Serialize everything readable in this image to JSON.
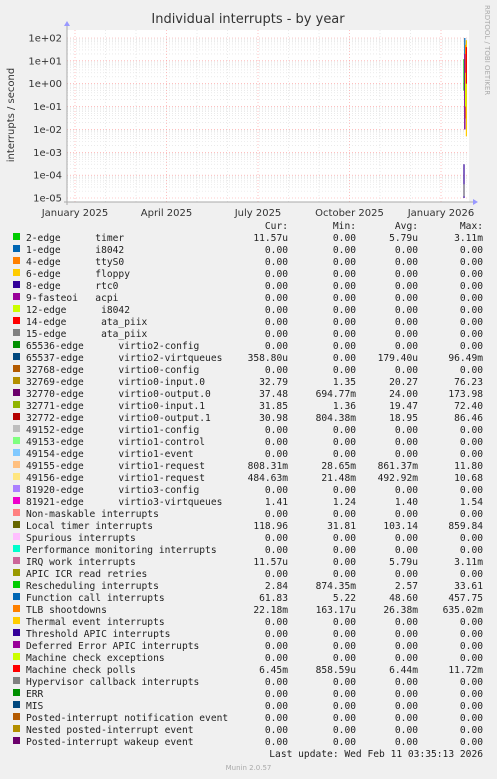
{
  "chart_data": {
    "type": "line",
    "title": "Individual interrupts - by year",
    "ylabel": "interrupts / second",
    "y_scale": "log",
    "y_ticks": [
      "1e-05",
      "1e-04",
      "1e-03",
      "1e-02",
      "1e-01",
      "1e+00",
      "1e+01",
      "1e+02"
    ],
    "x_ticks": [
      "January 2025",
      "April 2025",
      "July 2025",
      "October 2025",
      "January 2026"
    ],
    "grid": true,
    "side_label": "RRDTOOL / TOBI OETIKER",
    "series_visible_segments": [
      {
        "name": "2-edge timer",
        "color": "#00cc00",
        "values": [
          0.5,
          12
        ]
      },
      {
        "name": "65537-edge virtio2-virtqueues",
        "color": "#0066b3",
        "values": [
          0.01,
          100
        ]
      },
      {
        "name": "32769-edge virtio0-input.0",
        "color": "#ff8000",
        "values": [
          0.03,
          50
        ]
      },
      {
        "name": "32770-edge virtio0-output.0",
        "color": "#ffcc00",
        "values": [
          0.005,
          80
        ]
      },
      {
        "name": "Local timer interrupts",
        "color": "#330099",
        "values": [
          1e-05,
          0.0003
        ]
      },
      {
        "name": "Function call interrupts",
        "color": "#990099",
        "values": [
          0.01,
          20
        ]
      },
      {
        "name": "TLB shootdowns",
        "color": "#ccff00",
        "values": [
          0.1,
          3
        ]
      },
      {
        "name": "Rescheduling interrupts",
        "color": "#ff0000",
        "values": [
          1,
          40
        ]
      },
      {
        "name": "Machine check polls",
        "color": "#808080",
        "values": [
          1.2e-05,
          4e-05
        ]
      }
    ]
  },
  "legend": {
    "headers": {
      "cur": "Cur:",
      "min": "Min:",
      "avg": "Avg:",
      "max": "Max:"
    },
    "rows": [
      {
        "name": "2-edge      timer",
        "color": "#00cc00",
        "cur": "11.57u",
        "min": "0.00",
        "avg": "5.79u",
        "max": "3.11m"
      },
      {
        "name": "1-edge      i8042",
        "color": "#0066b3",
        "cur": "0.00",
        "min": "0.00",
        "avg": "0.00",
        "max": "0.00"
      },
      {
        "name": "4-edge      ttyS0",
        "color": "#ff8000",
        "cur": "0.00",
        "min": "0.00",
        "avg": "0.00",
        "max": "0.00"
      },
      {
        "name": "6-edge      floppy",
        "color": "#ffcc00",
        "cur": "0.00",
        "min": "0.00",
        "avg": "0.00",
        "max": "0.00"
      },
      {
        "name": "8-edge      rtc0",
        "color": "#330099",
        "cur": "0.00",
        "min": "0.00",
        "avg": "0.00",
        "max": "0.00"
      },
      {
        "name": "9-fasteoi   acpi",
        "color": "#990099",
        "cur": "0.00",
        "min": "0.00",
        "avg": "0.00",
        "max": "0.00"
      },
      {
        "name": "12-edge      i8042",
        "color": "#ccff00",
        "cur": "0.00",
        "min": "0.00",
        "avg": "0.00",
        "max": "0.00"
      },
      {
        "name": "14-edge      ata_piix",
        "color": "#ff0000",
        "cur": "0.00",
        "min": "0.00",
        "avg": "0.00",
        "max": "0.00"
      },
      {
        "name": "15-edge      ata_piix",
        "color": "#808080",
        "cur": "0.00",
        "min": "0.00",
        "avg": "0.00",
        "max": "0.00"
      },
      {
        "name": "65536-edge      virtio2-config",
        "color": "#008f00",
        "cur": "0.00",
        "min": "0.00",
        "avg": "0.00",
        "max": "0.00"
      },
      {
        "name": "65537-edge      virtio2-virtqueues",
        "color": "#00487d",
        "cur": "358.80u",
        "min": "0.00",
        "avg": "179.40u",
        "max": "96.49m"
      },
      {
        "name": "32768-edge      virtio0-config",
        "color": "#b35a00",
        "cur": "0.00",
        "min": "0.00",
        "avg": "0.00",
        "max": "0.00"
      },
      {
        "name": "32769-edge      virtio0-input.0",
        "color": "#b38f00",
        "cur": "32.79",
        "min": "1.35",
        "avg": "20.27",
        "max": "76.23"
      },
      {
        "name": "32770-edge      virtio0-output.0",
        "color": "#6b006b",
        "cur": "37.48",
        "min": "694.77m",
        "avg": "24.00",
        "max": "173.98"
      },
      {
        "name": "32771-edge      virtio0-input.1",
        "color": "#8fb300",
        "cur": "31.85",
        "min": "1.36",
        "avg": "19.47",
        "max": "72.40"
      },
      {
        "name": "32772-edge      virtio0-output.1",
        "color": "#b30000",
        "cur": "30.98",
        "min": "804.38m",
        "avg": "18.95",
        "max": "86.46"
      },
      {
        "name": "49152-edge      virtio1-config",
        "color": "#bebebe",
        "cur": "0.00",
        "min": "0.00",
        "avg": "0.00",
        "max": "0.00"
      },
      {
        "name": "49153-edge      virtio1-control",
        "color": "#80ff80",
        "cur": "0.00",
        "min": "0.00",
        "avg": "0.00",
        "max": "0.00"
      },
      {
        "name": "49154-edge      virtio1-event",
        "color": "#80c9ff",
        "cur": "0.00",
        "min": "0.00",
        "avg": "0.00",
        "max": "0.00"
      },
      {
        "name": "49155-edge      virtio1-request",
        "color": "#ffc080",
        "cur": "808.31m",
        "min": "28.65m",
        "avg": "861.37m",
        "max": "11.80"
      },
      {
        "name": "49156-edge      virtio1-request",
        "color": "#ffe680",
        "cur": "484.63m",
        "min": "21.48m",
        "avg": "492.92m",
        "max": "10.68"
      },
      {
        "name": "81920-edge      virtio3-config",
        "color": "#aa80ff",
        "cur": "0.00",
        "min": "0.00",
        "avg": "0.00",
        "max": "0.00"
      },
      {
        "name": "81921-edge      virtio3-virtqueues",
        "color": "#ee00cc",
        "cur": "1.41",
        "min": "1.24",
        "avg": "1.40",
        "max": "1.54"
      },
      {
        "name": "Non-maskable interrupts",
        "color": "#ff8080",
        "cur": "0.00",
        "min": "0.00",
        "avg": "0.00",
        "max": "0.00"
      },
      {
        "name": "Local timer interrupts",
        "color": "#666600",
        "cur": "118.96",
        "min": "31.81",
        "avg": "103.14",
        "max": "859.84"
      },
      {
        "name": "Spurious interrupts",
        "color": "#ffbfff",
        "cur": "0.00",
        "min": "0.00",
        "avg": "0.00",
        "max": "0.00"
      },
      {
        "name": "Performance monitoring interrupts",
        "color": "#00ffcc",
        "cur": "0.00",
        "min": "0.00",
        "avg": "0.00",
        "max": "0.00"
      },
      {
        "name": "IRQ work interrupts",
        "color": "#cc6699",
        "cur": "11.57u",
        "min": "0.00",
        "avg": "5.79u",
        "max": "3.11m"
      },
      {
        "name": "APIC ICR read retries",
        "color": "#999900",
        "cur": "0.00",
        "min": "0.00",
        "avg": "0.00",
        "max": "0.00"
      },
      {
        "name": "Rescheduling interrupts",
        "color": "#00cc00",
        "cur": "2.84",
        "min": "874.35m",
        "avg": "2.57",
        "max": "33.61"
      },
      {
        "name": "Function call interrupts",
        "color": "#0066b3",
        "cur": "61.83",
        "min": "5.22",
        "avg": "48.60",
        "max": "457.75"
      },
      {
        "name": "TLB shootdowns",
        "color": "#ff8000",
        "cur": "22.18m",
        "min": "163.17u",
        "avg": "26.38m",
        "max": "635.02m"
      },
      {
        "name": "Thermal event interrupts",
        "color": "#ffcc00",
        "cur": "0.00",
        "min": "0.00",
        "avg": "0.00",
        "max": "0.00"
      },
      {
        "name": "Threshold APIC interrupts",
        "color": "#330099",
        "cur": "0.00",
        "min": "0.00",
        "avg": "0.00",
        "max": "0.00"
      },
      {
        "name": "Deferred Error APIC interrupts",
        "color": "#990099",
        "cur": "0.00",
        "min": "0.00",
        "avg": "0.00",
        "max": "0.00"
      },
      {
        "name": "Machine check exceptions",
        "color": "#ccff00",
        "cur": "0.00",
        "min": "0.00",
        "avg": "0.00",
        "max": "0.00"
      },
      {
        "name": "Machine check polls",
        "color": "#ff0000",
        "cur": "6.45m",
        "min": "858.59u",
        "avg": "6.44m",
        "max": "11.72m"
      },
      {
        "name": "Hypervisor callback interrupts",
        "color": "#808080",
        "cur": "0.00",
        "min": "0.00",
        "avg": "0.00",
        "max": "0.00"
      },
      {
        "name": "ERR",
        "color": "#008f00",
        "cur": "0.00",
        "min": "0.00",
        "avg": "0.00",
        "max": "0.00"
      },
      {
        "name": "MIS",
        "color": "#00487d",
        "cur": "0.00",
        "min": "0.00",
        "avg": "0.00",
        "max": "0.00"
      },
      {
        "name": "Posted-interrupt notification event",
        "color": "#b35a00",
        "cur": "0.00",
        "min": "0.00",
        "avg": "0.00",
        "max": "0.00"
      },
      {
        "name": "Nested posted-interrupt event",
        "color": "#b38f00",
        "cur": "0.00",
        "min": "0.00",
        "avg": "0.00",
        "max": "0.00"
      },
      {
        "name": "Posted-interrupt wakeup event",
        "color": "#6b006b",
        "cur": "0.00",
        "min": "0.00",
        "avg": "0.00",
        "max": "0.00"
      }
    ]
  },
  "footer": {
    "last_update": "Last update: Wed Feb 11 03:35:13 2026",
    "version": "Munin 2.0.57"
  }
}
